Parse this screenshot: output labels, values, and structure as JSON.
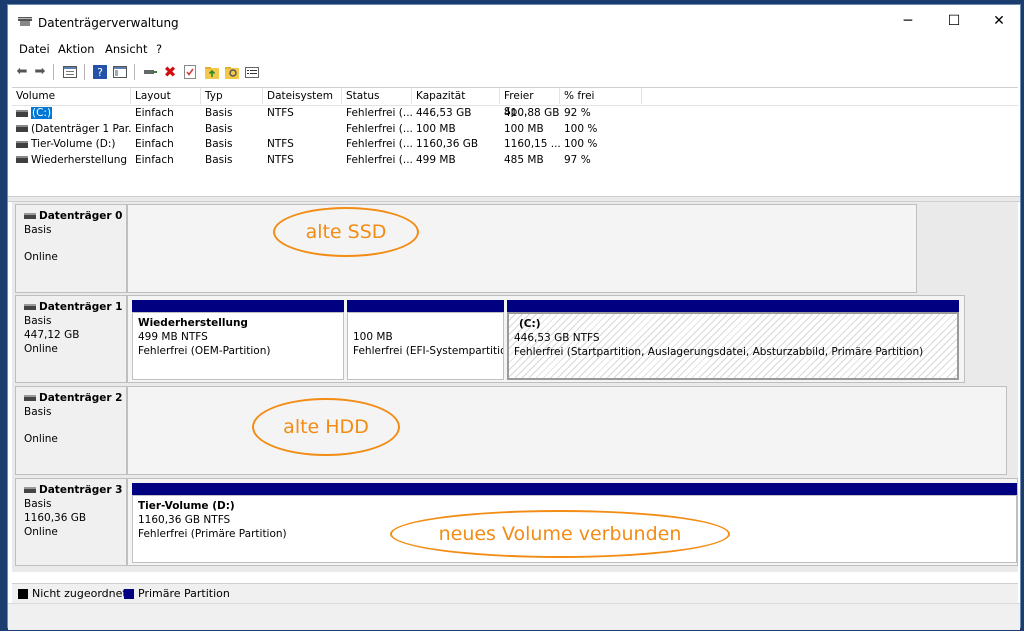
{
  "window": {
    "title": "Datenträgerverwaltung",
    "minimize_glyph": "─",
    "maximize_glyph": "☐",
    "close_glyph": "✕"
  },
  "menu": {
    "items": [
      "Datei",
      "Aktion",
      "Ansicht",
      "?"
    ]
  },
  "toolbar": {
    "icons": [
      "back-icon",
      "forward-icon",
      "properties-icon",
      "help-icon",
      "console-tree-icon",
      "connect-icon",
      "delete-icon",
      "check-icon",
      "folder-up-icon",
      "folder-search-icon",
      "list-icon"
    ]
  },
  "volumes": {
    "columns": [
      "Volume",
      "Layout",
      "Typ",
      "Dateisystem",
      "Status",
      "Kapazität",
      "Freier Sp...",
      "% frei"
    ],
    "rows": [
      [
        "(C:)",
        "Einfach",
        "Basis",
        "NTFS",
        "Fehlerfrei (...",
        "446,53 GB",
        "410,88 GB",
        "92 %"
      ],
      [
        "(Datenträger 1 Par...",
        "Einfach",
        "Basis",
        "",
        "Fehlerfrei (...",
        "100 MB",
        "100 MB",
        "100 %"
      ],
      [
        "Tier-Volume (D:)",
        "Einfach",
        "Basis",
        "NTFS",
        "Fehlerfrei (...",
        "1160,36 GB",
        "1160,15 ...",
        "100 %"
      ],
      [
        "Wiederherstellung",
        "Einfach",
        "Basis",
        "NTFS",
        "Fehlerfrei (...",
        "499 MB",
        "485 MB",
        "97 %"
      ]
    ]
  },
  "disks": [
    {
      "name": "Datenträger 0",
      "type": "Basis",
      "size": "",
      "state": "Online"
    },
    {
      "name": "Datenträger 1",
      "type": "Basis",
      "size": "447,12 GB",
      "state": "Online",
      "partitions": [
        {
          "title": "Wiederherstellung",
          "size": "499 MB NTFS",
          "status": "Fehlerfrei (OEM-Partition)"
        },
        {
          "title": "",
          "size": "100 MB",
          "status": "Fehlerfrei (EFI-Systempartition"
        },
        {
          "title": "(C:)",
          "size": "446,53 GB NTFS",
          "status": "Fehlerfrei (Startpartition, Auslagerungsdatei, Absturzabbild, Primäre Partition)"
        }
      ]
    },
    {
      "name": "Datenträger 2",
      "type": "Basis",
      "size": "",
      "state": "Online"
    },
    {
      "name": "Datenträger 3",
      "type": "Basis",
      "size": "1160,36 GB",
      "state": "Online",
      "partitions": [
        {
          "title": "Tier-Volume  (D:)",
          "size": "1160,36 GB NTFS",
          "status": "Fehlerfrei (Primäre Partition)"
        }
      ]
    }
  ],
  "annotations": {
    "ssd": "alte SSD",
    "hdd": "alte HDD",
    "volume": "neues Volume verbunden"
  },
  "legend": {
    "unallocated": "Nicht zugeordnet",
    "primary": "Primäre Partition"
  },
  "colors": {
    "primary_partition": "#000080",
    "unallocated": "#000000",
    "annotation": "#f28c14",
    "selection": "#0078d7"
  }
}
